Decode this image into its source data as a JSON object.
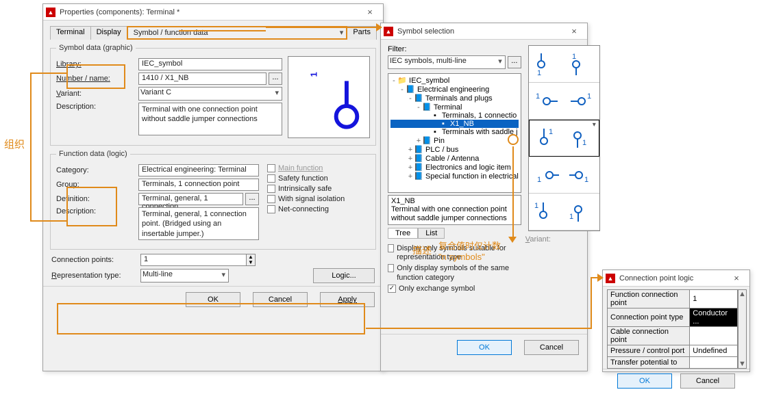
{
  "properties_window": {
    "title": "Properties (components): Terminal *",
    "tabs": [
      "Terminal",
      "Display",
      "Symbol / function data",
      "Parts"
    ],
    "active_tab_index": 2,
    "symbol_data": {
      "legend": "Symbol data (graphic)",
      "library_label": "Library:",
      "library_value": "IEC_symbol",
      "number_label": "Number / name:",
      "number_value": "1410 / X1_NB",
      "variant_label": "Variant:",
      "variant_value": "Variant C",
      "description_label": "Description:",
      "description_value": "Terminal with one connection point without saddle jumper connections"
    },
    "function_data": {
      "legend": "Function data (logic)",
      "category_label": "Category:",
      "category_value": "Electrical engineering: Terminal",
      "group_label": "Group:",
      "group_value": "Terminals, 1 connection point",
      "definition_label": "Definition:",
      "definition_value": "Terminal, general, 1 connection",
      "description_label": "Description:",
      "description_value": "Terminal, general, 1 connection point. (Bridged using an insertable jumper.)",
      "checks": {
        "main": "Main function",
        "safety": "Safety function",
        "intrinsic": "Intrinsically safe",
        "signal": "With signal isolation",
        "net": "Net-connecting"
      }
    },
    "bottom": {
      "cp_label": "Connection points:",
      "cp_value": "1",
      "rep_label": "Representation type:",
      "rep_value": "Multi-line",
      "logic_btn": "Logic..."
    },
    "buttons": {
      "ok": "OK",
      "cancel": "Cancel",
      "apply": "Apply"
    }
  },
  "symbol_selection": {
    "title": "Symbol selection",
    "filter_label": "Filter:",
    "filter_value": "IEC symbols, multi-line",
    "tree": [
      {
        "d": 0,
        "exp": "-",
        "ico": "📁",
        "t": "IEC_symbol"
      },
      {
        "d": 1,
        "exp": "-",
        "ico": "📘",
        "t": "Electrical engineering"
      },
      {
        "d": 2,
        "exp": "-",
        "ico": "📘",
        "t": "Terminals and plugs"
      },
      {
        "d": 3,
        "exp": "-",
        "ico": "📘",
        "t": "Terminal"
      },
      {
        "d": 4,
        "exp": " ",
        "ico": "▪",
        "t": "Terminals, 1 connectio"
      },
      {
        "d": 5,
        "exp": " ",
        "ico": "▪",
        "t": "X1_NB",
        "sel": true
      },
      {
        "d": 4,
        "exp": " ",
        "ico": "▪",
        "t": "Terminals with saddle j"
      },
      {
        "d": 3,
        "exp": "+",
        "ico": "📘",
        "t": "Pin"
      },
      {
        "d": 2,
        "exp": "+",
        "ico": "📘",
        "t": "PLC / bus"
      },
      {
        "d": 2,
        "exp": "+",
        "ico": "📘",
        "t": "Cable / Antenna"
      },
      {
        "d": 2,
        "exp": "+",
        "ico": "📘",
        "t": "Electronics and logic item"
      },
      {
        "d": 2,
        "exp": "+",
        "ico": "📘",
        "t": "Special function in electrical"
      }
    ],
    "desc_name": "X1_NB",
    "desc_text": "Terminal with one connection point without saddle jumper connections",
    "small_tabs": [
      "Tree",
      "List"
    ],
    "checks": {
      "suitable": "Display only symbols suitable for representation type",
      "samefunc": "Only display symbols of the same function category",
      "exchange": "Only exchange symbol"
    },
    "variants_label": "Variant:",
    "buttons": {
      "ok": "OK",
      "cancel": "Cancel"
    }
  },
  "cp_logic": {
    "title": "Connection point logic",
    "rows": [
      {
        "k": "Function connection point",
        "v": "1"
      },
      {
        "k": "Connection point type",
        "v": "Conductor ..."
      },
      {
        "k": "Cable connection point",
        "v": ""
      },
      {
        "k": "Pressure / control port",
        "v": "Undefined"
      },
      {
        "k": "Transfer potential to",
        "v": ""
      }
    ],
    "buttons": {
      "ok": "OK",
      "cancel": "Cancel"
    }
  },
  "annotations": {
    "left": "组织",
    "desc_line1": "描述",
    "desc_line2": "复合值时仅计数",
    "desc_line3": "\"n symbols\""
  }
}
